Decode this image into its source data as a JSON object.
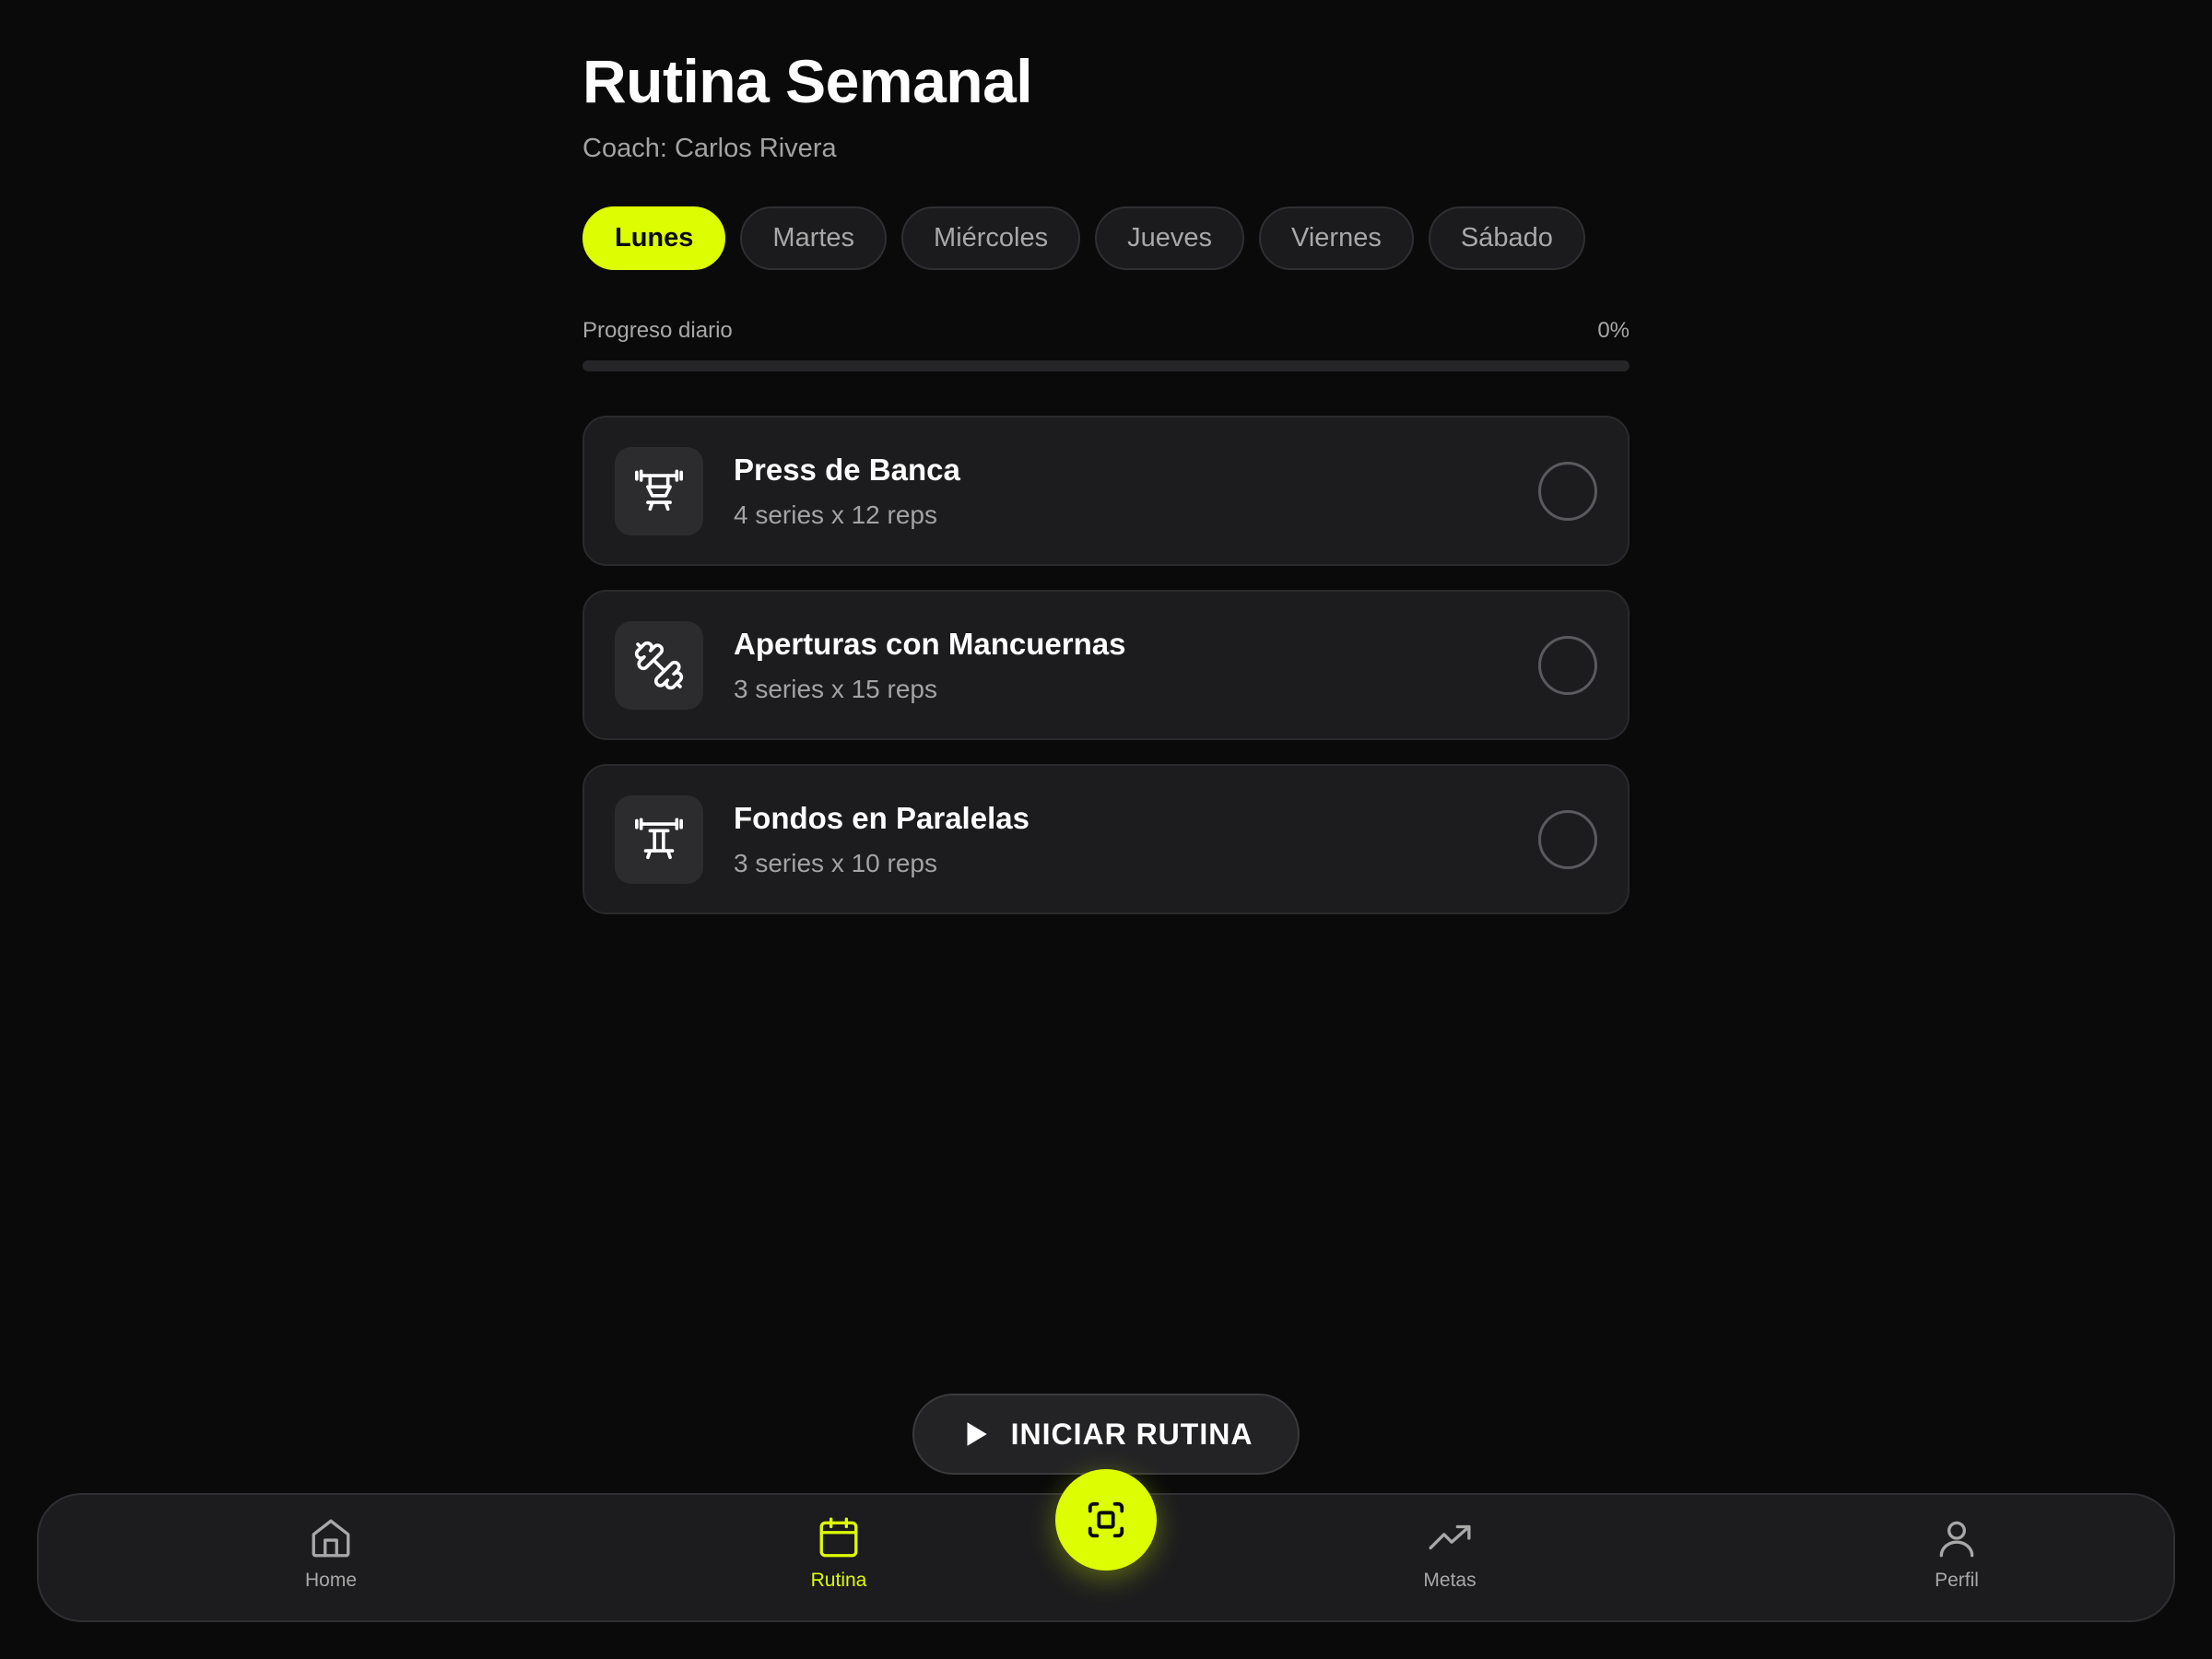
{
  "header": {
    "title": "Rutina Semanal",
    "coach": "Coach: Carlos Rivera"
  },
  "days": [
    {
      "label": "Lunes",
      "active": true
    },
    {
      "label": "Martes",
      "active": false
    },
    {
      "label": "Miércoles",
      "active": false
    },
    {
      "label": "Jueves",
      "active": false
    },
    {
      "label": "Viernes",
      "active": false
    },
    {
      "label": "Sábado",
      "active": false
    }
  ],
  "progress": {
    "label": "Progreso diario",
    "value_text": "0%",
    "value": 0
  },
  "exercises": [
    {
      "name": "Press de Banca",
      "detail": "4 series x 12 reps",
      "icon": "bench-press-icon",
      "done": false
    },
    {
      "name": "Aperturas con Mancuernas",
      "detail": "3 series x 15 reps",
      "icon": "dumbbell-icon",
      "done": false
    },
    {
      "name": "Fondos en Paralelas",
      "detail": "3 series x 10 reps",
      "icon": "parallel-bars-icon",
      "done": false
    }
  ],
  "start_button": {
    "label": "INICIAR RUTINA",
    "icon": "play-icon"
  },
  "nav": {
    "items": [
      {
        "label": "Home",
        "icon": "home-icon",
        "active": false
      },
      {
        "label": "Rutina",
        "icon": "calendar-icon",
        "active": true
      },
      {
        "label": "Metas",
        "icon": "trending-up-icon",
        "active": false
      },
      {
        "label": "Perfil",
        "icon": "user-icon",
        "active": false
      }
    ],
    "fab_icon": "scan-icon"
  },
  "colors": {
    "accent": "#dcfd02",
    "background": "#0a0a0a",
    "card": "#1c1c1e",
    "muted_text": "#a3a3a3"
  }
}
